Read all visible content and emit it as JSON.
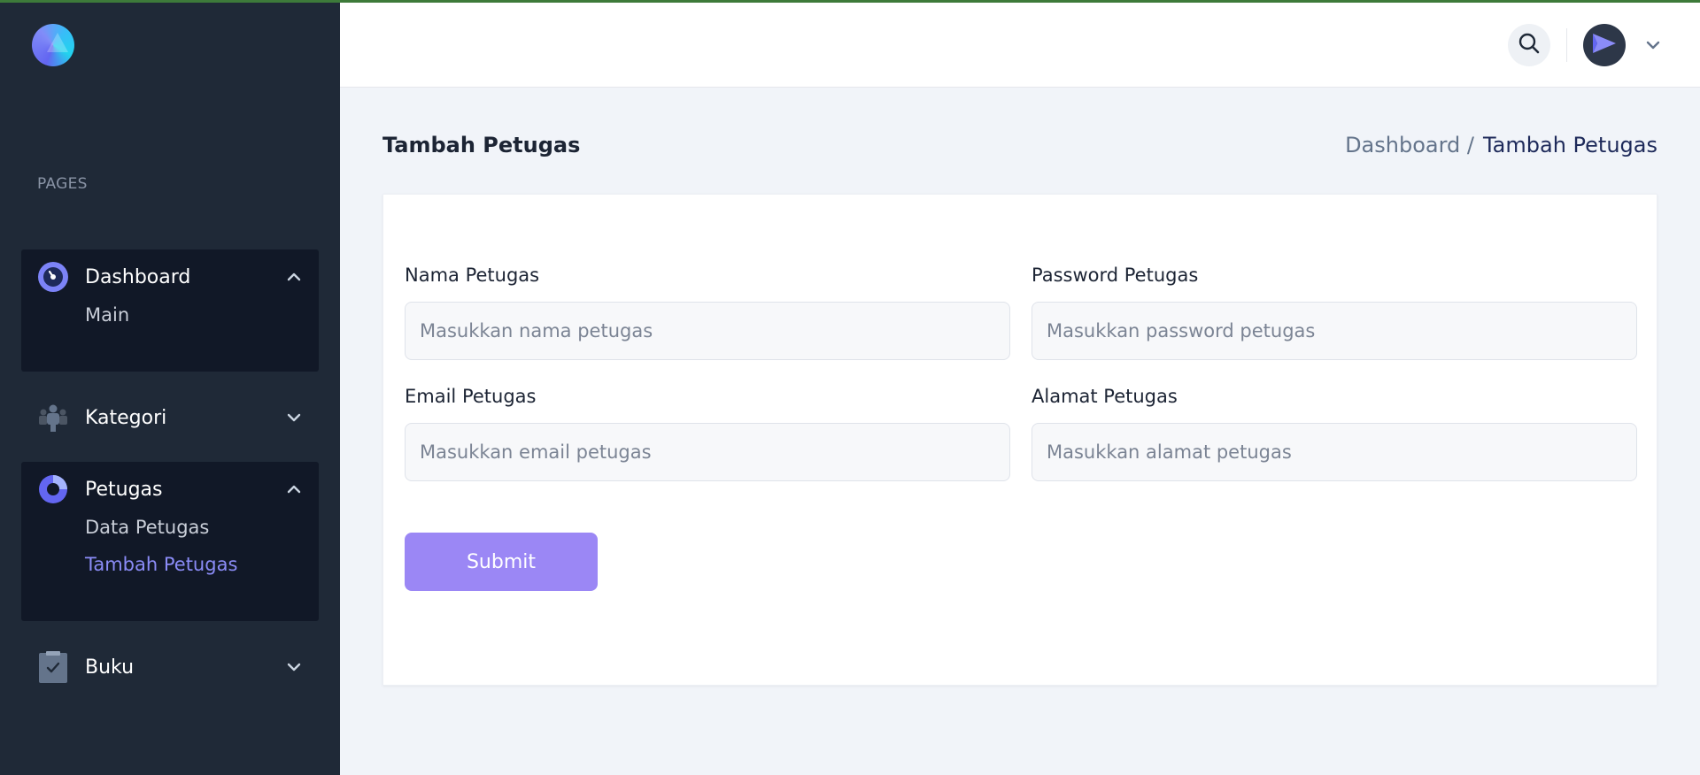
{
  "sidebar": {
    "section_label": "PAGES",
    "items": [
      {
        "label": "Dashboard",
        "icon": "dashboard-gauge-icon",
        "expanded": true,
        "children": [
          {
            "label": "Main"
          }
        ]
      },
      {
        "label": "Kategori",
        "icon": "users-group-icon",
        "expanded": false,
        "children": []
      },
      {
        "label": "Petugas",
        "icon": "pie-chart-icon",
        "expanded": true,
        "children": [
          {
            "label": "Data Petugas"
          },
          {
            "label": "Tambah Petugas",
            "current": true
          }
        ]
      },
      {
        "label": "Buku",
        "icon": "clipboard-check-icon",
        "expanded": false,
        "children": []
      }
    ]
  },
  "header": {
    "search_icon": "search-icon",
    "avatar_icon": "paper-plane-icon",
    "menu_icon": "chevron-down-icon"
  },
  "page": {
    "title": "Tambah Petugas",
    "breadcrumb": {
      "parent": "Dashboard /",
      "current": "Tambah Petugas"
    }
  },
  "form": {
    "nama": {
      "label": "Nama Petugas",
      "placeholder": "Masukkan nama petugas",
      "value": ""
    },
    "password": {
      "label": "Password Petugas",
      "placeholder": "Masukkan password petugas",
      "value": ""
    },
    "email": {
      "label": "Email Petugas",
      "placeholder": "Masukkan email petugas",
      "value": ""
    },
    "alamat": {
      "label": "Alamat Petugas",
      "placeholder": "Masukkan alamat petugas",
      "value": ""
    },
    "submit_label": "Submit"
  },
  "colors": {
    "sidebar_bg": "#1f2937",
    "sidebar_active_bg": "#111827",
    "accent": "#8b8cf7",
    "submit_bg": "#9b87f5",
    "top_line": "#3d7a3a"
  }
}
